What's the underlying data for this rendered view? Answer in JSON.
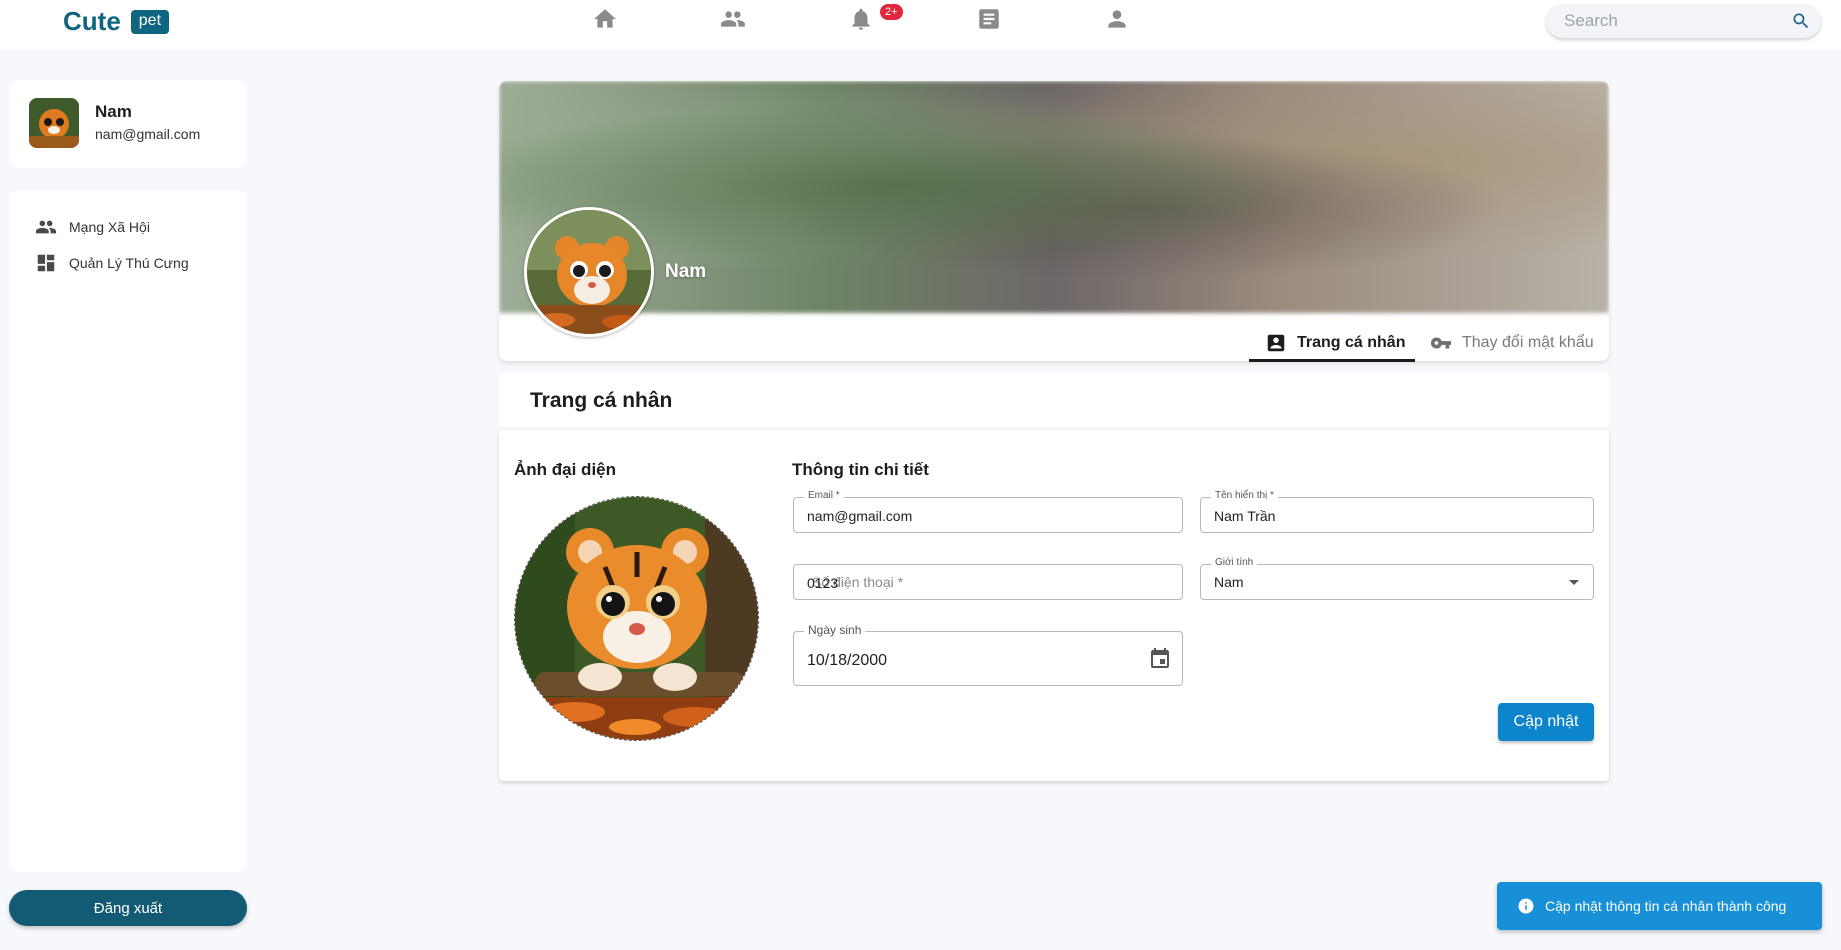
{
  "brand": {
    "name": "Cute",
    "badge": "pet"
  },
  "nav": {
    "notification_badge": "2+",
    "icons": [
      "home-icon",
      "group-icon",
      "bell-icon",
      "article-icon",
      "person-icon"
    ]
  },
  "search": {
    "placeholder": "Search",
    "value": ""
  },
  "sidebar": {
    "user": {
      "name": "Nam",
      "email": "nam@gmail.com"
    },
    "items": [
      {
        "label": "Mạng Xã Hội",
        "icon": "people-icon"
      },
      {
        "label": "Quản Lý Thú Cưng",
        "icon": "dashboard-icon"
      }
    ],
    "logout_label": "Đăng xuất"
  },
  "profile": {
    "name": "Nam",
    "tabs": [
      {
        "label": "Trang cá nhân",
        "icon": "contact-card-icon",
        "active": true
      },
      {
        "label": "Thay đổi mật khẩu",
        "icon": "key-icon",
        "active": false
      }
    ]
  },
  "section": {
    "title": "Trang cá nhân",
    "avatar_heading": "Ảnh đại diện",
    "details_heading": "Thông tin chi tiết"
  },
  "form": {
    "email": {
      "label": "Email *",
      "value": "nam@gmail.com"
    },
    "display_name": {
      "label": "Tên hiển thị *",
      "value": "Nam Trần"
    },
    "phone": {
      "placeholder": "Số điện thoại *",
      "value": "0123"
    },
    "gender": {
      "label": "Giới tính",
      "value": "Nam"
    },
    "birthday": {
      "label": "Ngày sinh",
      "value": "10/18/2000"
    },
    "submit_label": "Cập nhật"
  },
  "toast": {
    "message": "Cập nhật thông tin cá nhân thành công"
  },
  "colors": {
    "brand": "#0f6580",
    "primary_button": "#0d85cd",
    "toast": "#1790d8",
    "badge": "#e2263c"
  }
}
